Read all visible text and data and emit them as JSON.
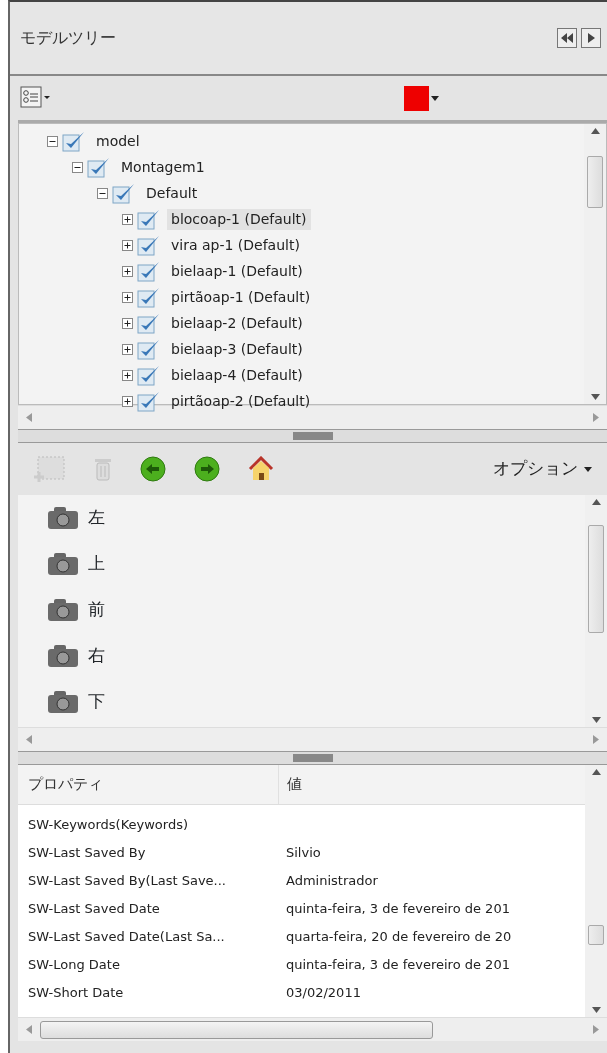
{
  "panel": {
    "title": "モデルツリー"
  },
  "tree": [
    {
      "label": "model",
      "expanded": true,
      "checked": true,
      "selected": false,
      "children": [
        {
          "label": "Montagem1",
          "expanded": true,
          "checked": true,
          "selected": false,
          "children": [
            {
              "label": "Default",
              "expanded": true,
              "checked": true,
              "selected": false,
              "children": [
                {
                  "label": "blocoap-1 (Default)",
                  "expanded": false,
                  "checked": true,
                  "selected": true
                },
                {
                  "label": "vira ap-1 (Default)",
                  "expanded": false,
                  "checked": true,
                  "selected": false
                },
                {
                  "label": "bielaap-1 (Default)",
                  "expanded": false,
                  "checked": true,
                  "selected": false
                },
                {
                  "label": "pirtãoap-1 (Default)",
                  "expanded": false,
                  "checked": true,
                  "selected": false
                },
                {
                  "label": "bielaap-2 (Default)",
                  "expanded": false,
                  "checked": true,
                  "selected": false
                },
                {
                  "label": "bielaap-3 (Default)",
                  "expanded": false,
                  "checked": true,
                  "selected": false
                },
                {
                  "label": "bielaap-4 (Default)",
                  "expanded": false,
                  "checked": true,
                  "selected": false
                },
                {
                  "label": "pirtãoap-2 (Default)",
                  "expanded": false,
                  "checked": true,
                  "selected": false
                }
              ]
            }
          ]
        }
      ]
    }
  ],
  "color_swatch": {
    "color": "#ee0000"
  },
  "views_toolbar": {
    "options_label": "オプション"
  },
  "views": [
    {
      "label": "左"
    },
    {
      "label": "上"
    },
    {
      "label": "前"
    },
    {
      "label": "右"
    },
    {
      "label": "下"
    }
  ],
  "properties": {
    "columns": [
      "プロパティ",
      "値"
    ],
    "rows": [
      [
        "SW-Keywords(Keywords)",
        ""
      ],
      [
        "SW-Last Saved By",
        "Silvio"
      ],
      [
        "SW-Last Saved By(Last Save...",
        "Administrador"
      ],
      [
        "SW-Last Saved Date",
        "quinta-feira, 3 de fevereiro de 201"
      ],
      [
        "SW-Last Saved Date(Last Sa...",
        "quarta-feira, 20 de fevereiro de 20"
      ],
      [
        "SW-Long Date",
        "quinta-feira, 3 de fevereiro de 201"
      ],
      [
        "SW-Short Date",
        "03/02/2011"
      ]
    ]
  }
}
